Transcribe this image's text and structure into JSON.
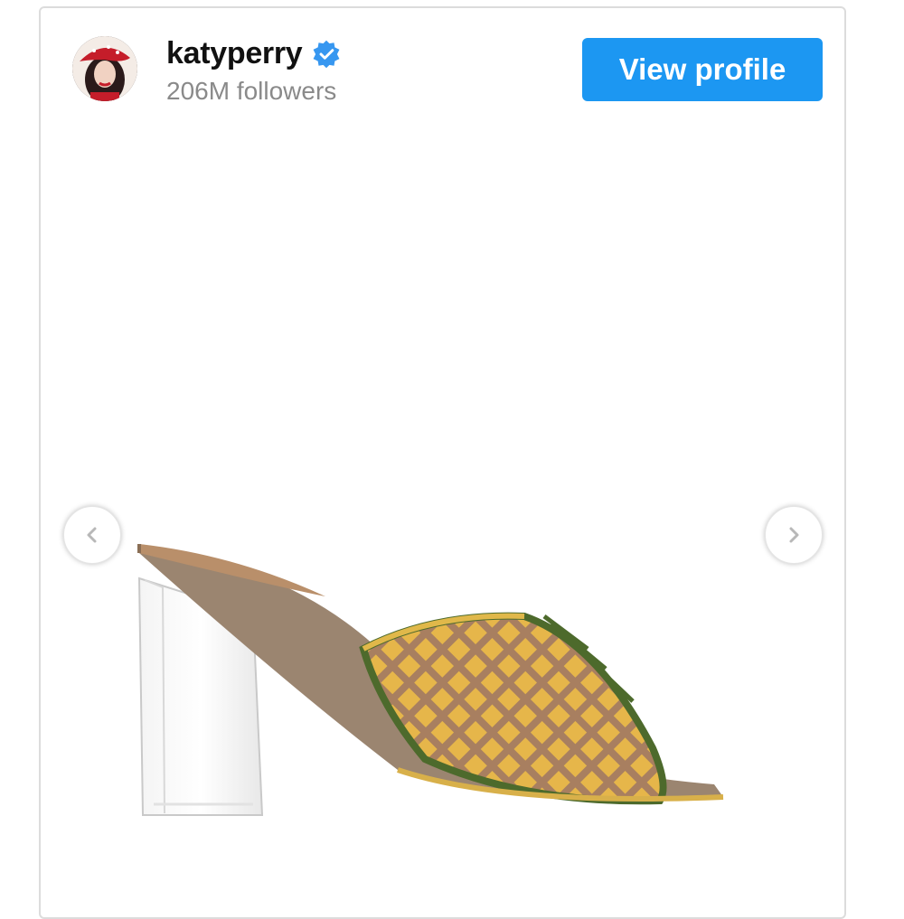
{
  "profile": {
    "username": "katyperry",
    "followers": "206M followers",
    "verified_icon": "verified-badge-icon",
    "avatar_icon": "avatar"
  },
  "actions": {
    "view_profile_label": "View profile"
  },
  "carousel": {
    "prev_icon": "chevron-left-icon",
    "next_icon": "chevron-right-icon"
  },
  "colors": {
    "accent": "#1c97f2",
    "verified": "#3797f0"
  }
}
